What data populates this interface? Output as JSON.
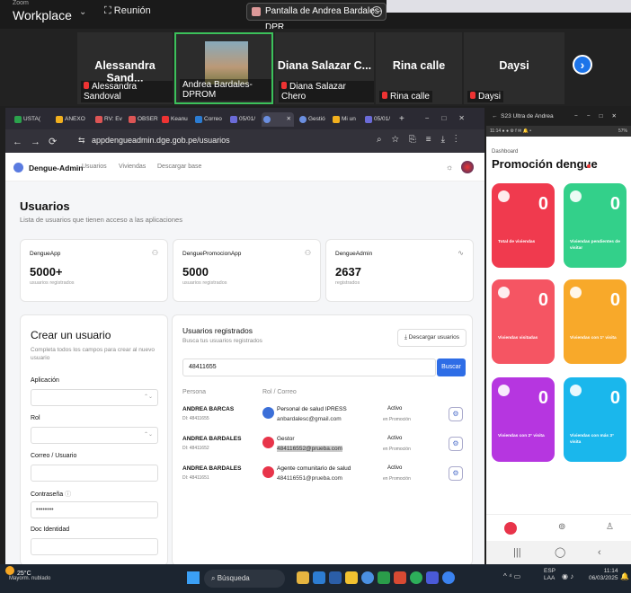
{
  "zoom": {
    "small_label": "Zoom",
    "app_name": "Workplace",
    "meeting_label": "Reunión",
    "share_banner": "Pantalla de Andrea Bardales-DPR"
  },
  "gallery": [
    {
      "big_name": "Alessandra Sand...",
      "label": "Alessandra Sandoval"
    },
    {
      "big_name": "",
      "label": "Andrea Bardales-DPROM"
    },
    {
      "big_name": "Diana Salazar C...",
      "label": "Diana Salazar Chero"
    },
    {
      "big_name": "Rina calle",
      "label": "Rina calle"
    },
    {
      "big_name": "Daysi",
      "label": "Daysi"
    }
  ],
  "browser": {
    "tabs": [
      "USTA(",
      "ANEXO",
      "RV: Ev",
      "OBSER",
      "Keanu",
      "Correo",
      "05/01/",
      "",
      "Gestió",
      "Mi un",
      "05/01/"
    ],
    "url": "appdengueadmin.dge.gob.pe/usuarios"
  },
  "app": {
    "name": "Dengue-Admin",
    "nav": [
      "Usuarios",
      "Viviendas",
      "Descargar base"
    ],
    "title": "Usuarios",
    "subtitle": "Lista de usuarios que tienen acceso a las aplicaciones",
    "stats": [
      {
        "title": "DengueApp",
        "value": "5000+",
        "sub": "usuarios registrados"
      },
      {
        "title": "DenguePromocionApp",
        "value": "5000",
        "sub": "usuarios registrados"
      },
      {
        "title": "DengueAdmin",
        "value": "2637",
        "sub": "registrados"
      }
    ],
    "create": {
      "title": "Crear un usuario",
      "subtitle": "Completa todos los campos para crear al nuevo usuario",
      "fields": [
        {
          "label": "Aplicación",
          "value": ""
        },
        {
          "label": "Rol",
          "value": ""
        },
        {
          "label": "Correo / Usuario",
          "value": ""
        },
        {
          "label": "Contraseña",
          "value": "••••••••"
        },
        {
          "label": "Doc Identidad",
          "value": ""
        }
      ]
    },
    "users": {
      "title": "Usuarios registrados",
      "subtitle": "Busca tus usuarios registrados",
      "download_label": "Descargar usuarios",
      "search_value": "48411655",
      "search_label": "Buscar",
      "col_persona": "Persona",
      "col_rol": "Rol / Correo",
      "rows": [
        {
          "name": "ANDREA BARCAS",
          "doc": "DI: 48411655",
          "role": "Personal de salud IPRESS",
          "email": "anbardalesc@gmail.com",
          "status": "Activo",
          "app": "en Promoción",
          "icon_color": "#3b6fd8"
        },
        {
          "name": "ANDREA BARDALES",
          "doc": "DI: 48411652",
          "role": "Gestor",
          "email": "484116552@prueba.com",
          "status": "Activo",
          "app": "en Promoción",
          "icon_color": "#e8344a"
        },
        {
          "name": "ANDREA BARDALES",
          "doc": "DI: 48411651",
          "role": "Agente comunitario de salud",
          "email": "484116551@prueba.com",
          "status": "Activo",
          "app": "en Promoción",
          "icon_color": "#e8344a"
        }
      ]
    }
  },
  "phone": {
    "window_title": "S23 Ultra de Andrea",
    "status_left": "11:14",
    "status_right": "57%",
    "dash_label": "Dashboard",
    "title": "Promoción dengue",
    "cards": [
      {
        "value": "0",
        "label": "Total de viviendas",
        "color": "#f03a4e"
      },
      {
        "value": "0",
        "label": "Viviendas pendientes de visitar",
        "color": "#33d08a"
      },
      {
        "value": "0",
        "label": "Viviendas visitadas",
        "color": "#f55563"
      },
      {
        "value": "0",
        "label": "Viviendas con 1° visita",
        "color": "#f8a92a"
      },
      {
        "value": "0",
        "label": "Viviendas con 2° visita",
        "color": "#b636e0"
      },
      {
        "value": "0",
        "label": "Viviendas con más 3° visita",
        "color": "#1ab7ec"
      }
    ]
  },
  "taskbar": {
    "temp": "25°C",
    "weather": "Mayorm. nublado",
    "search": "Búsqueda",
    "lang1": "ESP",
    "lang2": "LAA",
    "time": "11:14",
    "date": "06/03/2025"
  }
}
